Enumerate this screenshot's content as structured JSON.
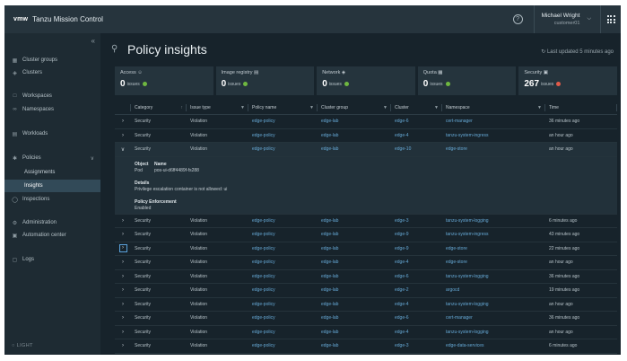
{
  "header": {
    "logo": "vmw",
    "app_title": "Tanzu Mission Control",
    "help": "?",
    "user_name": "Michael Wright",
    "user_role": "customer01"
  },
  "sidebar": {
    "items": [
      {
        "label": "Cluster groups"
      },
      {
        "label": "Clusters"
      },
      {
        "label": "Workspaces"
      },
      {
        "label": "Namespaces"
      },
      {
        "label": "Workloads"
      },
      {
        "label": "Policies"
      },
      {
        "label": "Assignments"
      },
      {
        "label": "Insights"
      },
      {
        "label": "Inspections"
      },
      {
        "label": "Administration"
      },
      {
        "label": "Automation center"
      },
      {
        "label": "Logs"
      }
    ],
    "theme_toggle": "LIGHT"
  },
  "page": {
    "title": "Policy insights",
    "updated": "Last updated 5 minutes ago"
  },
  "cards": [
    {
      "label": "Access",
      "count": "0",
      "unit": "issues",
      "status": "green"
    },
    {
      "label": "Image registry",
      "count": "0",
      "unit": "issues",
      "status": "green"
    },
    {
      "label": "Network",
      "count": "0",
      "unit": "issues",
      "status": "green"
    },
    {
      "label": "Quota",
      "count": "0",
      "unit": "issues",
      "status": "green"
    },
    {
      "label": "Security",
      "count": "267",
      "unit": "issues",
      "status": "red"
    }
  ],
  "table": {
    "columns": [
      "Category",
      "Issue type",
      "Policy name",
      "Cluster group",
      "Cluster",
      "Namespace",
      "Time"
    ],
    "rows": [
      {
        "category": "Security",
        "issue": "Violation",
        "policy": "edge-policy",
        "group": "edge-lab",
        "cluster": "edge-6",
        "ns": "cert-manager",
        "time": "36 minutes ago"
      },
      {
        "category": "Security",
        "issue": "Violation",
        "policy": "edge-policy",
        "group": "edge-lab",
        "cluster": "edge-4",
        "ns": "tanzu-system-ingress",
        "time": "an hour ago"
      },
      {
        "category": "Security",
        "issue": "Violation",
        "policy": "edge-policy",
        "group": "edge-lab",
        "cluster": "edge-10",
        "ns": "edge-store",
        "time": "an hour ago"
      },
      {
        "category": "Security",
        "issue": "Violation",
        "policy": "edge-policy",
        "group": "edge-lab",
        "cluster": "edge-3",
        "ns": "tanzu-system-logging",
        "time": "6 minutes ago"
      },
      {
        "category": "Security",
        "issue": "Violation",
        "policy": "edge-policy",
        "group": "edge-lab",
        "cluster": "edge-9",
        "ns": "tanzu-system-ingress",
        "time": "43 minutes ago"
      },
      {
        "category": "Security",
        "issue": "Violation",
        "policy": "edge-policy",
        "group": "edge-lab",
        "cluster": "edge-9",
        "ns": "edge-store",
        "time": "22 minutes ago"
      },
      {
        "category": "Security",
        "issue": "Violation",
        "policy": "edge-policy",
        "group": "edge-lab",
        "cluster": "edge-4",
        "ns": "edge-store",
        "time": "an hour ago"
      },
      {
        "category": "Security",
        "issue": "Violation",
        "policy": "edge-policy",
        "group": "edge-lab",
        "cluster": "edge-6",
        "ns": "tanzu-system-logging",
        "time": "36 minutes ago"
      },
      {
        "category": "Security",
        "issue": "Violation",
        "policy": "edge-policy",
        "group": "edge-lab",
        "cluster": "edge-2",
        "ns": "argocd",
        "time": "19 minutes ago"
      },
      {
        "category": "Security",
        "issue": "Violation",
        "policy": "edge-policy",
        "group": "edge-lab",
        "cluster": "edge-4",
        "ns": "tanzu-system-logging",
        "time": "an hour ago"
      },
      {
        "category": "Security",
        "issue": "Violation",
        "policy": "edge-policy",
        "group": "edge-lab",
        "cluster": "edge-6",
        "ns": "cert-manager",
        "time": "36 minutes ago"
      },
      {
        "category": "Security",
        "issue": "Violation",
        "policy": "edge-policy",
        "group": "edge-lab",
        "cluster": "edge-4",
        "ns": "tanzu-system-logging",
        "time": "an hour ago"
      },
      {
        "category": "Security",
        "issue": "Violation",
        "policy": "edge-policy",
        "group": "edge-lab",
        "cluster": "edge-3",
        "ns": "edge-data-services",
        "time": "6 minutes ago"
      }
    ],
    "detail": {
      "object_label": "Object",
      "name_label": "Name",
      "object_value": "Pod",
      "name_value": "pos-ui-d6ff4489f-fs288",
      "details_label": "Details",
      "details_value": "Privilege escalation container is not allowed: ui",
      "enforcement_label": "Policy Enforcement",
      "enforcement_value": "Enabled"
    }
  }
}
